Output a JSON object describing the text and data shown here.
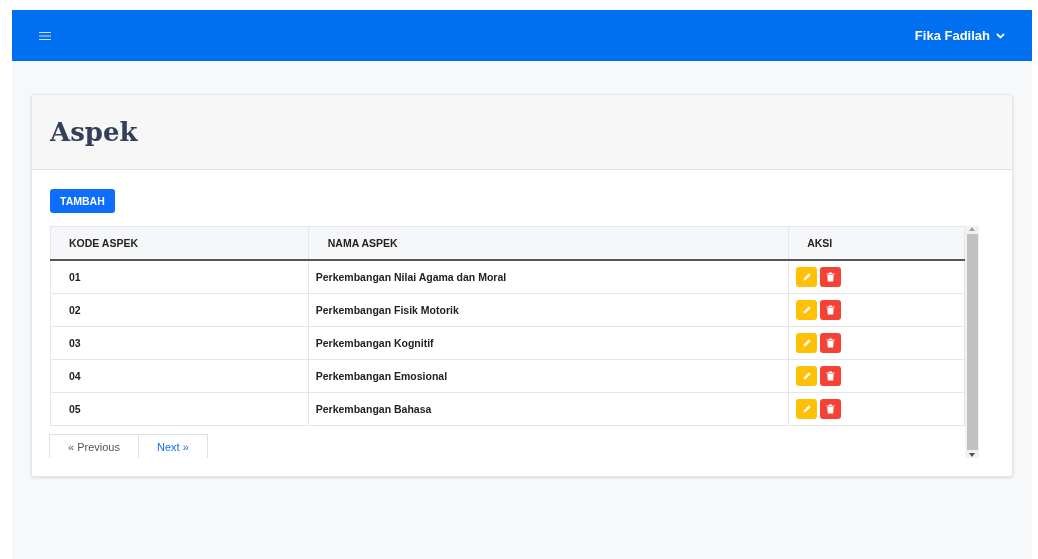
{
  "navbar": {
    "user": "Fika Fadilah"
  },
  "page": {
    "title": "Aspek",
    "add_button": "TAMBAH"
  },
  "table": {
    "columns": [
      "KODE ASPEK",
      "NAMA ASPEK",
      "AKSI"
    ],
    "rows": [
      {
        "code": "01",
        "name": "Perkembangan Nilai Agama dan Moral"
      },
      {
        "code": "02",
        "name": "Perkembangan Fisik Motorik"
      },
      {
        "code": "03",
        "name": "Perkembangan Kognitif"
      },
      {
        "code": "04",
        "name": "Perkembangan Emosional"
      },
      {
        "code": "05",
        "name": "Perkembangan Bahasa"
      }
    ]
  },
  "pagination": [
    {
      "label": "« Previous",
      "disabled": true
    },
    {
      "label": "Next »",
      "disabled": false
    }
  ]
}
